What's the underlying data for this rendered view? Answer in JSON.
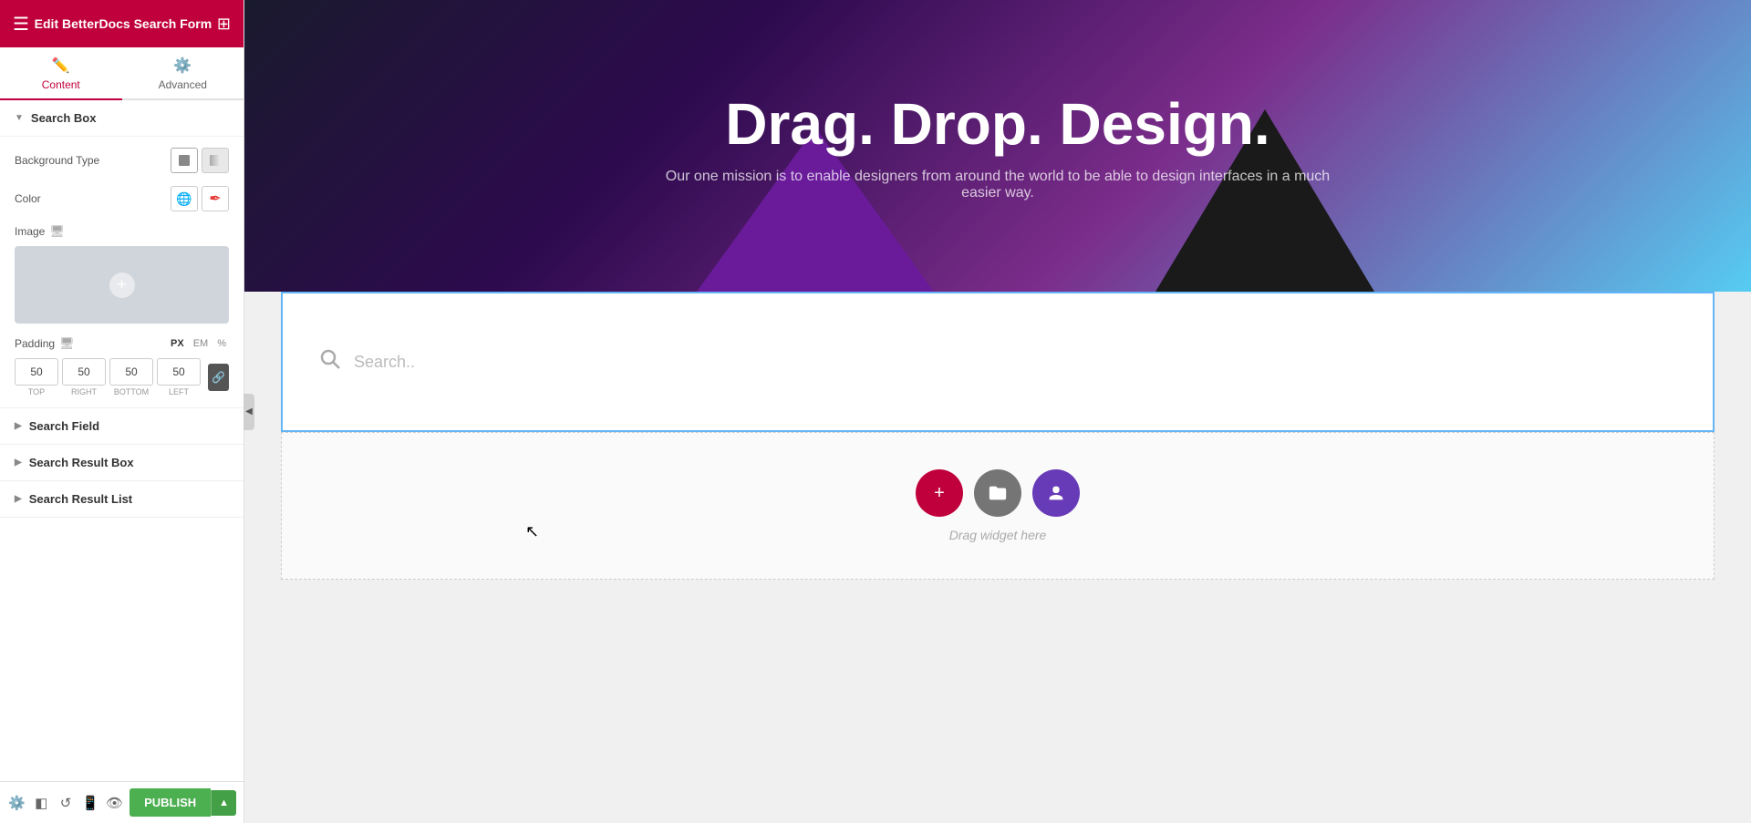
{
  "topbar": {
    "title": "Edit BetterDocs Search Form"
  },
  "tabs": [
    {
      "id": "content",
      "label": "Content",
      "icon": "✏️",
      "active": true
    },
    {
      "id": "advanced",
      "label": "Advanced",
      "icon": "⚙️",
      "active": false
    }
  ],
  "sections": {
    "search_box": {
      "label": "Search Box",
      "expanded": true,
      "background_type_label": "Background Type",
      "color_label": "Color",
      "image_label": "Image",
      "padding_label": "Padding",
      "padding_values": {
        "top": "50",
        "right": "50",
        "bottom": "50",
        "left": "50"
      },
      "padding_units": [
        "PX",
        "EM",
        "%"
      ]
    },
    "search_field": {
      "label": "Search Field",
      "expanded": false
    },
    "search_result_box": {
      "label": "Search Result Box",
      "expanded": false
    },
    "search_result_list": {
      "label": "Search Result List",
      "expanded": false
    }
  },
  "hero": {
    "title": "Drag. Drop. Design.",
    "subtitle": "Our one mission is to enable designers from around the world to be able to design interfaces in a much easier way."
  },
  "search_field": {
    "placeholder": "Search.."
  },
  "drop_zone": {
    "label": "Drag widget here"
  },
  "toolbar": {
    "publish_label": "PUBLISH"
  }
}
